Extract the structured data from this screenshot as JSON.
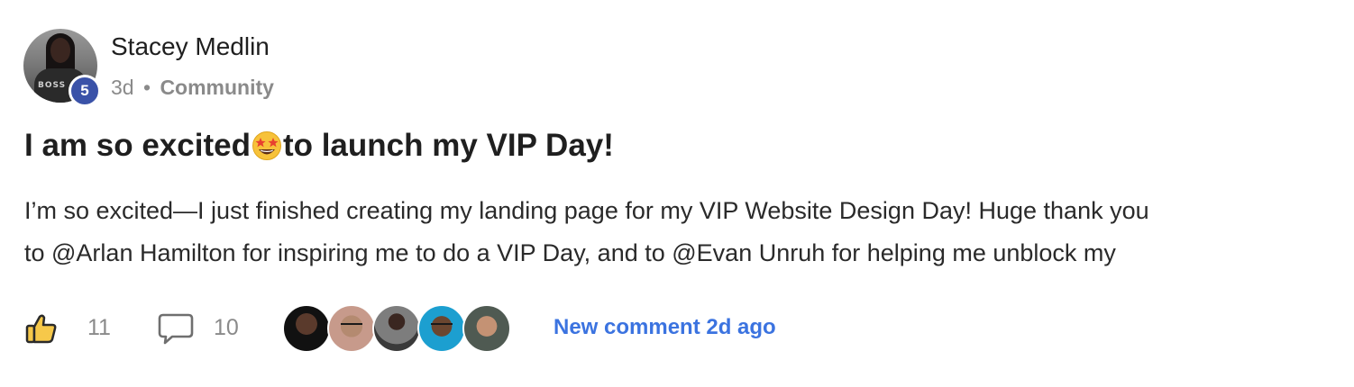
{
  "post": {
    "author": {
      "name": "Stacey Medlin",
      "level": "5",
      "avatar_shirt_text": "BOSS"
    },
    "meta": {
      "time": "3d",
      "separator": "•",
      "category": "Community"
    },
    "title": {
      "before_emoji": "I am so excited",
      "emoji": "star-struck-face-icon",
      "after_emoji": "to launch my VIP Day!"
    },
    "body_lines": [
      "I’m so excited—I just finished creating my landing page for my VIP Website Design Day! Huge thank you",
      "to @Arlan Hamilton for inspiring me to do a VIP Day, and to @Evan Unruh for helping me unblock my"
    ],
    "footer": {
      "like_icon": "thumbs-up-icon",
      "like_count": "11",
      "comment_icon": "speech-bubble-icon",
      "comment_count": "10",
      "commenter_count": 5,
      "new_comment_label": "New comment 2d ago"
    },
    "colors": {
      "level_badge": "#3a52a8",
      "link": "#3b73e0",
      "muted": "#8a8a8a",
      "text": "#1f1f1f"
    }
  }
}
